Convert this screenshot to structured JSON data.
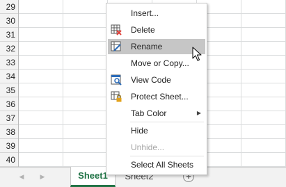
{
  "rows": [
    "29",
    "30",
    "31",
    "32",
    "33",
    "34",
    "35",
    "36",
    "37",
    "38",
    "39",
    "40"
  ],
  "tabs": {
    "nav_prev": "◀",
    "nav_next": "▶",
    "sheets": [
      {
        "label": "Sheet1",
        "active": true
      },
      {
        "label": "Sheet2",
        "active": false
      }
    ],
    "add_sheet": "+"
  },
  "context_menu": {
    "items": [
      {
        "label": "Insert...",
        "icon": null
      },
      {
        "label": "Delete",
        "icon": "delete-sheet-icon"
      },
      {
        "label": "Rename",
        "icon": "rename-sheet-icon",
        "highlighted": true
      },
      {
        "label": "Move or Copy...",
        "icon": null
      },
      {
        "label": "View Code",
        "icon": "view-code-icon"
      },
      {
        "label": "Protect Sheet...",
        "icon": "protect-sheet-icon"
      },
      {
        "label": "Tab Color",
        "icon": null,
        "submenu": true
      },
      {
        "label": "Hide",
        "icon": null
      },
      {
        "label": "Unhide...",
        "icon": null,
        "disabled": true
      },
      {
        "label": "Select All Sheets",
        "icon": null
      }
    ],
    "submenu_arrow": "▶"
  },
  "colors": {
    "accent": "#217346",
    "highlight": "#c6c6c6",
    "delete_mark": "#e0413a",
    "lock": "#e3a21a"
  }
}
